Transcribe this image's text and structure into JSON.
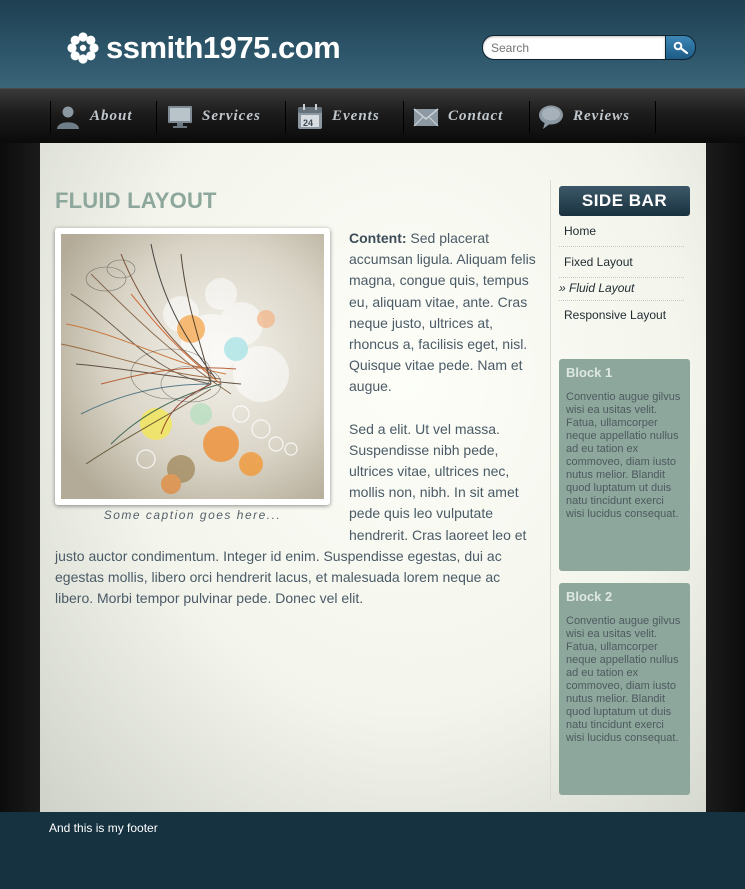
{
  "header": {
    "site_name": "ssmith1975.com",
    "logo_icon": "flower-icon",
    "search": {
      "placeholder": "Search",
      "button_icon": "search-key-icon"
    }
  },
  "nav": {
    "items": [
      {
        "label": "About",
        "icon": "user-icon"
      },
      {
        "label": "Services",
        "icon": "monitor-icon"
      },
      {
        "label": "Events",
        "icon": "calendar-icon",
        "icon_text": "24"
      },
      {
        "label": "Contact",
        "icon": "envelope-icon"
      },
      {
        "label": "Reviews",
        "icon": "speech-bubble-icon"
      }
    ]
  },
  "main": {
    "title": "FLUID LAYOUT",
    "image_caption": "Some caption goes here...",
    "content_label": "Content:",
    "paragraph1": " Sed placerat accumsan ligula. Aliquam felis magna, congue quis, tempus eu, aliquam vitae, ante. Cras neque justo, ultrices at, rhoncus a, facilisis eget, nisl. Quisque vitae pede. Nam et augue.",
    "paragraph2": "Sed a elit. Ut vel massa. Suspendisse nibh pede, ultrices vitae, ultrices nec, mollis non, nibh. In sit amet pede quis leo vulputate hendrerit. Cras laoreet leo et justo auctor condimentum. Integer id enim. Suspendisse egestas, dui ac egestas mollis, libero orci hendrerit lacus, et malesuada lorem neque ac libero. Morbi tempor pulvinar pede. Donec vel elit."
  },
  "sidebar": {
    "title": "SIDE BAR",
    "links": [
      {
        "label": "Home",
        "active": false
      },
      {
        "label": "Fixed Layout",
        "active": false
      },
      {
        "label": "» Fluid Layout",
        "active": true
      },
      {
        "label": "Responsive Layout",
        "active": false
      }
    ],
    "blocks": [
      {
        "title": "Block 1",
        "text": "Conventio augue gilvus wisi ea usitas velit. Fatua, ullamcorper neque appellatio nullus ad eu tation ex commoveo, diam iusto nutus melior. Blandit quod luptatum ut duis natu tincidunt exerci wisi lucidus consequat."
      },
      {
        "title": "Block 2",
        "text": "Conventio augue gilvus wisi ea usitas velit. Fatua, ullamcorper neque appellatio nullus ad eu tation ex commoveo, diam iusto nutus melior. Blandit quod luptatum ut duis natu tincidunt exerci wisi lucidus consequat."
      }
    ]
  },
  "footer": {
    "text": "And this is my footer"
  },
  "colors": {
    "header_bg": "#2c5468",
    "nav_bg": "#1c1c1c",
    "title_accent": "#8ea79c",
    "block_bg": "#8ea79c",
    "footer_bg": "#163241"
  }
}
